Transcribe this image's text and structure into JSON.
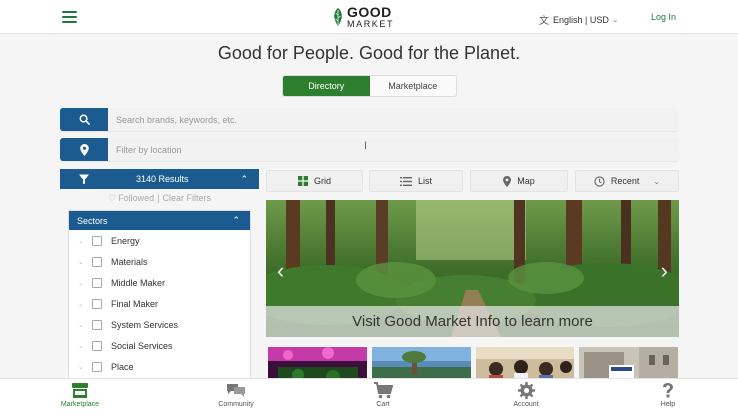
{
  "header": {
    "logo_top": "GOOD",
    "logo_bottom": "MARKET",
    "language": "English | USD",
    "login_label": "Log In"
  },
  "tagline": "Good for People. Good for the Planet.",
  "tabs": [
    {
      "label": "Directory",
      "active": true
    },
    {
      "label": "Marketplace",
      "active": false
    }
  ],
  "search": {
    "keywords_placeholder": "Search brands, keywords, etc.",
    "location_placeholder": "Filter by location"
  },
  "filters": {
    "results_label": "3140 Results",
    "followed_label": "Followed",
    "clear_label": "Clear Filters",
    "sectors_title": "Sectors",
    "sectors": [
      "Energy",
      "Materials",
      "Middle Maker",
      "Final Maker",
      "System Services",
      "Social Services",
      "Place"
    ]
  },
  "views": {
    "grid_label": "Grid",
    "list_label": "List",
    "map_label": "Map",
    "sort_label": "Recent"
  },
  "carousel": {
    "caption": "Visit Good Market Info to learn more"
  },
  "bottom_nav": [
    {
      "label": "Marketplace",
      "icon": "store-icon",
      "active": true
    },
    {
      "label": "Community",
      "icon": "chat-icon",
      "active": false
    },
    {
      "label": "Cart",
      "icon": "cart-icon",
      "active": false
    },
    {
      "label": "Account",
      "icon": "gear-icon",
      "active": false
    },
    {
      "label": "Help",
      "icon": "question-icon",
      "active": false
    }
  ],
  "colors": {
    "brand_green": "#2d7e2e",
    "brand_blue": "#1b5b8f"
  }
}
